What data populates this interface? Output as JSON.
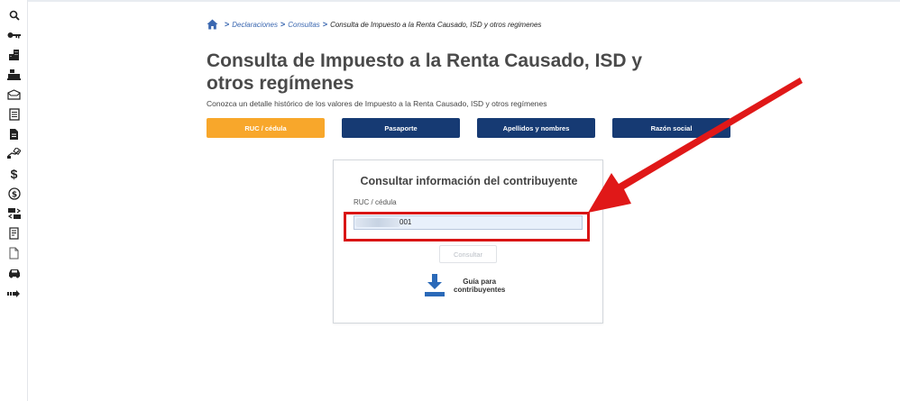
{
  "sidebar": {
    "icons": [
      "search-icon",
      "key-icon",
      "buildings-icon",
      "cash-register-icon",
      "open-box-icon",
      "document-list-icon",
      "document-icon",
      "hand-tag-icon",
      "dollar-icon",
      "dollar-circle-icon",
      "money-transfer-icon",
      "receipt-icon",
      "file-icon",
      "car-icon",
      "arrow-right-icon"
    ],
    "dollar_glyph": "$"
  },
  "breadcrumb": {
    "item1": "Declaraciones",
    "item2": "Consultas",
    "current": "Consulta de Impuesto a la Renta Causado, ISD y otros regimenes",
    "separator": ">"
  },
  "page": {
    "title": "Consulta de Impuesto a la Renta Causado, ISD y otros regímenes",
    "subtitle": "Conozca un detalle histórico de los valores de Impuesto a la Renta Causado, ISD y otros regímenes"
  },
  "tabs": [
    {
      "label": "RUC / cédula",
      "active": true
    },
    {
      "label": "Pasaporte",
      "active": false
    },
    {
      "label": "Apellidos y nombres",
      "active": false
    },
    {
      "label": "Razón social",
      "active": false
    }
  ],
  "form": {
    "heading": "Consultar información del contribuyente",
    "field_label": "RUC / cédula",
    "field_value_visible": "001",
    "submit_label": "Consultar",
    "guide_line1": "Guía para",
    "guide_line2": "contribuyentes"
  },
  "colors": {
    "primary": "#163a73",
    "active_tab": "#f8a72b",
    "highlight": "#d91515",
    "link": "#3a67b0"
  }
}
